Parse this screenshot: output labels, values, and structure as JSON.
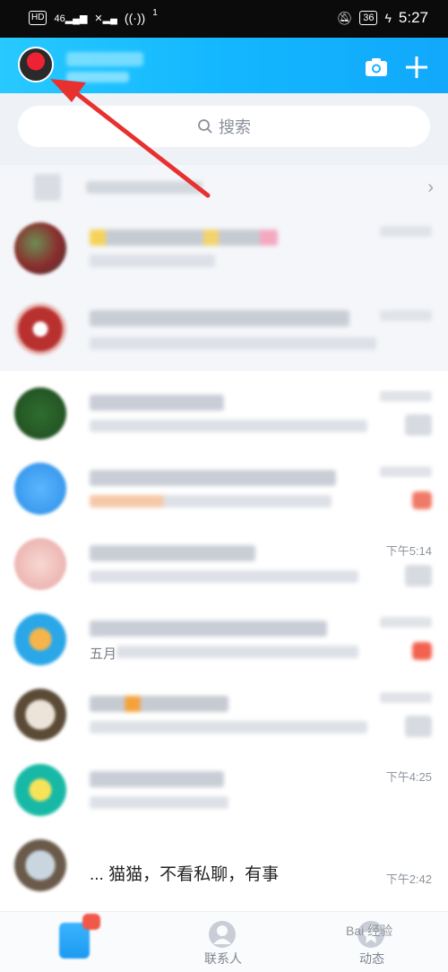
{
  "status_bar": {
    "left_items": [
      "HD",
      "46",
      "1"
    ],
    "battery": "36",
    "time": "5:27"
  },
  "header": {
    "camera_icon": "camera-icon",
    "add_icon": "plus-icon"
  },
  "search": {
    "placeholder": "搜索"
  },
  "chats": [
    {
      "time": ""
    },
    {
      "time": ""
    },
    {
      "time": ""
    },
    {
      "time": ""
    },
    {
      "time": "下午5:14"
    },
    {
      "time": ""
    },
    {
      "time": ""
    },
    {
      "time": "下午4:25"
    },
    {
      "time": "下午2:42"
    }
  ],
  "chat_snippets": {
    "row5_prefix": "五月",
    "row8_text": "... 猫猫，不看私聊，有事"
  },
  "tabs": [
    {
      "label": "",
      "icon": "message-icon"
    },
    {
      "label": "联系人",
      "icon": "contacts-icon"
    },
    {
      "label": "动态",
      "icon": "star-icon"
    }
  ],
  "watermark": "Bai 经验",
  "colors": {
    "header_start": "#27c9ff",
    "header_end": "#12a8fb",
    "annotation_arrow": "#e8312f"
  }
}
